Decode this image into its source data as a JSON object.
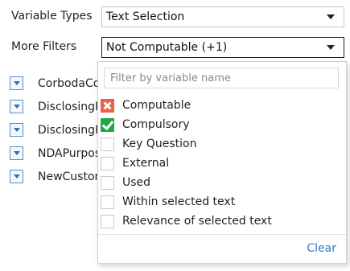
{
  "filters": {
    "variable_types_label": "Variable Types",
    "variable_types_value": "Text Selection",
    "more_filters_label": "More Filters",
    "more_filters_value": "Not Computable (+1)"
  },
  "variables": [
    {
      "name": "CorbodaCo"
    },
    {
      "name": "DisclosingP"
    },
    {
      "name": "DisclosingP"
    },
    {
      "name": "NDAPurpos"
    },
    {
      "name": "NewCustor"
    }
  ],
  "dropdown": {
    "search_placeholder": "Filter by variable name",
    "search_value": "",
    "options": [
      {
        "label": "Computable",
        "state": "excluded"
      },
      {
        "label": "Compulsory",
        "state": "checked"
      },
      {
        "label": "Key Question",
        "state": "unchecked"
      },
      {
        "label": "External",
        "state": "unchecked"
      },
      {
        "label": "Used",
        "state": "unchecked"
      },
      {
        "label": "Within selected text",
        "state": "unchecked"
      },
      {
        "label": "Relevance of selected text",
        "state": "unchecked"
      }
    ],
    "clear_label": "Clear"
  },
  "colors": {
    "excluded": "#e8624a",
    "checked": "#23a645",
    "link": "#2e7bc4",
    "expand_icon": "#2f6fb3"
  }
}
